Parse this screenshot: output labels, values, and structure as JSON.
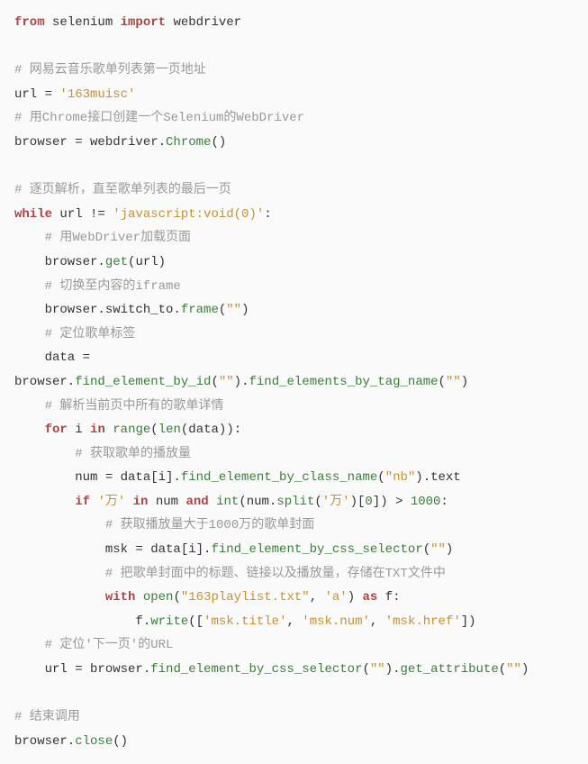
{
  "code": {
    "line1": {
      "kw1": "from",
      "mod": " selenium ",
      "kw2": "import",
      "imp": " webdriver"
    },
    "line3_comment": "# 网易云音乐歌单列表第一页地址",
    "line4": {
      "pre": "url = ",
      "str": "'163muisc'"
    },
    "line5_comment": "# 用Chrome接口创建一个Selenium的WebDriver",
    "line6": {
      "pre": "browser = webdriver.",
      "func": "Chrome",
      "post": "()"
    },
    "line8_comment": "# 逐页解析，直至歌单列表的最后一页",
    "line9": {
      "kw": "while",
      "mid": " url != ",
      "str": "'javascript:void(0)'",
      "colon": ":"
    },
    "line10_comment": "    # 用WebDriver加载页面",
    "line11": {
      "pre": "    browser.",
      "func": "get",
      "post": "(url)"
    },
    "line12_comment": "    # 切换至内容的iframe",
    "line13": {
      "pre": "    browser.switch_to.",
      "func": "frame",
      "post": "(",
      "str": "\"\"",
      "post2": ")"
    },
    "line14_comment": "    # 定位歌单标签",
    "line15": "    data =",
    "line16": {
      "pre": "browser.",
      "func1": "find_element_by_id",
      "mid1": "(",
      "str1": "\"\"",
      "mid2": ").",
      "func2": "find_elements_by_tag_name",
      "mid3": "(",
      "str2": "\"\"",
      "post": ")"
    },
    "line17_comment": "    # 解析当前页中所有的歌单详情",
    "line18": {
      "sp": "    ",
      "kw1": "for",
      "mid1": " i ",
      "kw2": "in",
      "mid2": " ",
      "func1": "range",
      "mid3": "(",
      "func2": "len",
      "post": "(data)):"
    },
    "line19_comment": "        # 获取歌单的播放量",
    "line20": {
      "pre": "        num = data[i].",
      "func": "find_element_by_class_name",
      "mid": "(",
      "str": "\"nb\"",
      "post": ").text"
    },
    "line21": {
      "sp": "        ",
      "kw1": "if",
      "mid1": " ",
      "str1": "'万'",
      "mid2": " ",
      "kw2": "in",
      "mid3": " num ",
      "kw3": "and",
      "mid4": " ",
      "func1": "int",
      "mid5": "(num.",
      "func2": "split",
      "mid6": "(",
      "str2": "'万'",
      "mid7": ")[",
      "num1": "0",
      "mid8": "]) > ",
      "num2": "1000",
      "colon": ":"
    },
    "line22_comment": "            # 获取播放量大于1000万的歌单封面",
    "line23": {
      "pre": "            msk = data[i].",
      "func": "find_element_by_css_selector",
      "mid": "(",
      "str": "\"\"",
      "post": ")"
    },
    "line24_comment": "            # 把歌单封面中的标题、链接以及播放量，存储在TXT文件中",
    "line25": {
      "sp": "            ",
      "kw1": "with",
      "mid1": " ",
      "func": "open",
      "mid2": "(",
      "str1": "\"163playlist.txt\"",
      "mid3": ", ",
      "str2": "'a'",
      "mid4": ") ",
      "kw2": "as",
      "post": " f:"
    },
    "line26": {
      "pre": "                f.",
      "func": "write",
      "mid": "([",
      "str1": "'msk.title'",
      "comma1": ", ",
      "str2": "'msk.num'",
      "comma2": ", ",
      "str3": "'msk.href'",
      "post": "])"
    },
    "line27_comment": "    # 定位'下一页'的URL",
    "line28": {
      "pre": "    url = browser.",
      "func1": "find_element_by_css_selector",
      "mid1": "(",
      "str1": "\"\"",
      "mid2": ").",
      "func2": "get_attribute",
      "mid3": "(",
      "str2": "\"\"",
      "post": ")"
    },
    "line30_comment": "# 结束调用",
    "line31": {
      "pre": "browser.",
      "func": "close",
      "post": "()"
    }
  }
}
